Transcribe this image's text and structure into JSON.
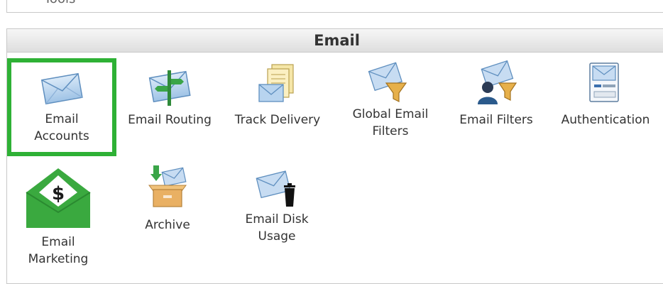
{
  "previous_section": {
    "cut_label": "Tools"
  },
  "email": {
    "title": "Email",
    "items": [
      {
        "label": "Email\nAccounts",
        "icon": "envelope-icon"
      },
      {
        "label": "Email Routing",
        "icon": "routing-sign-icon"
      },
      {
        "label": "Track Delivery",
        "icon": "documents-envelope-icon"
      },
      {
        "label": "Global Email\nFilters",
        "icon": "funnel-envelope-icon"
      },
      {
        "label": "Email Filters",
        "icon": "user-funnel-icon"
      },
      {
        "label": "Authentication",
        "icon": "id-card-envelope-icon"
      },
      {
        "label": "Email\nMarketing",
        "icon": "dollar-envelope-icon"
      },
      {
        "label": "Archive",
        "icon": "archive-box-icon"
      },
      {
        "label": "Email Disk\nUsage",
        "icon": "envelope-trash-icon"
      }
    ]
  },
  "colors": {
    "selection_border": "#2eb135",
    "marketing_green": "#3aa93f"
  }
}
